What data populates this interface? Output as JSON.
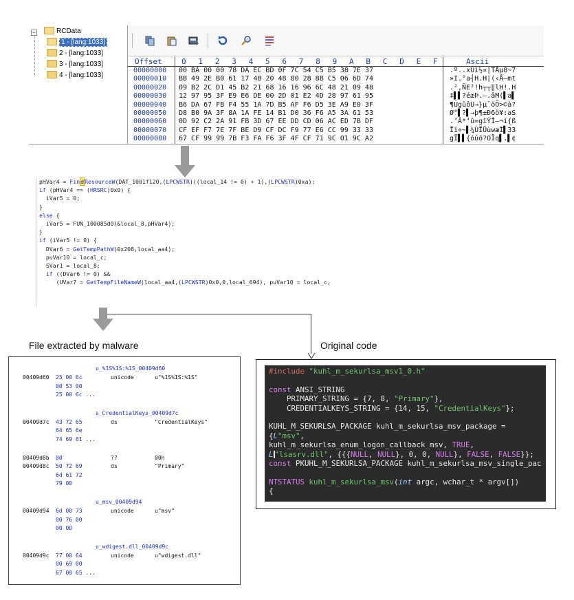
{
  "tree": {
    "root": "RCData",
    "items": [
      "1 - [lang:1033]",
      "2 - [lang:1033]",
      "3 - [lang:1033]",
      "4 - [lang:1033]"
    ]
  },
  "hex": {
    "header": {
      "offset": "Offset",
      "cols": [
        "0",
        "1",
        "2",
        "3",
        "4",
        "5",
        "6",
        "7",
        "8",
        "9",
        "A",
        "B",
        "C",
        "D",
        "E",
        "F"
      ],
      "ascii": "Ascii"
    },
    "rows": [
      {
        "offset": "00000000",
        "bytes": "00 BA 00 00 78 DA EC BD 0F 7C 54 C5 B5 38 7E 37",
        "ascii": ".º..xÚì½¤|TÅµ8~7"
      },
      {
        "offset": "00000010",
        "bytes": "BB 49 2E B0 61 17 48 20 48 80 28 8B C5 06 6D 74",
        "ascii": "»I.°a┤H.H|(‹Å–mt"
      },
      {
        "offset": "00000020",
        "bytes": "09 B2 2C D1 45 B2 21 68 16 16 96 6C 48 21 09 48",
        "ascii": ".²,ÑE²!h┬┬‖lH!.H"
      },
      {
        "offset": "00000030",
        "bytes": "12 97 95 3F E9 E6 DE 00 2D 01 E2 4D 28 97 61 95",
        "ascii": "‡▌▌?éæÞ.–.âM(▌a▌"
      },
      {
        "offset": "00000040",
        "bytes": "B6 DA 67 FB F4 55 1A 7D B5 AF F6 D5 3E A9 E0 3F",
        "ascii": "¶ÚgûôU→}µ¯öÕ>©à?"
      },
      {
        "offset": "00000050",
        "bytes": "D8 B0 9A 3F 8A 1A FE 14 B1 D0 36 F6 A5 3A 61 53",
        "ascii": "Ø°▌?▌→þ¶±Ð6ö¥:aS"
      },
      {
        "offset": "00000060",
        "bytes": "0D 92 C2 2A 91 FB 3D 67 EE DD CD 06 AC ED 7B DF",
        "ascii": ".’Â*‘û=gîÝÍ–¬í{ß"
      },
      {
        "offset": "00000070",
        "bytes": "CF EF F7 7E 7F BE D9 CF DC F9 77 E6 CC 99 33 33",
        "ascii": "Ïï÷~▌¾ÙÏÜùwæÌ▌33"
      },
      {
        "offset": "00000080",
        "bytes": "67 CF 99 99 7B F3 FA F6 3F 4F CF 71 9C 01 9C A2",
        "ascii": "gÏ▌▌{óúö?OÏq▌.▌¢"
      }
    ]
  },
  "decompiled": [
    [
      {
        "t": "pHVar4 = "
      },
      {
        "t": "Fin",
        "c": "fn"
      },
      {
        "t": "d",
        "c": "hl"
      },
      {
        "t": "ResourceW",
        "c": "fn"
      },
      {
        "t": "(DAT_1001f120,("
      },
      {
        "t": "LPCWSTR",
        "c": "kw"
      },
      {
        "t": ")((local_14 != 0) + 1),("
      },
      {
        "t": "LPCWSTR",
        "c": "kw"
      },
      {
        "t": ")0xa);"
      }
    ],
    [
      {
        "t": "if",
        "c": "kw"
      },
      {
        "t": " (pHVar4 == ("
      },
      {
        "t": "HRSRC",
        "c": "kw"
      },
      {
        "t": ")0x0) {"
      }
    ],
    [
      {
        "t": "  iVar5 = 0;"
      }
    ],
    [
      {
        "t": "}"
      }
    ],
    [
      {
        "t": "else",
        "c": "kw"
      },
      {
        "t": " {"
      }
    ],
    [
      {
        "t": "  iVar5 = FUN_100085d0(&local_8,pHVar4);"
      }
    ],
    [
      {
        "t": "}"
      }
    ],
    [
      {
        "t": "if",
        "c": "kw"
      },
      {
        "t": " (iVar5 != 0) {"
      }
    ],
    [
      {
        "t": "  DVar6 = "
      },
      {
        "t": "GetTempPathW",
        "c": "fn"
      },
      {
        "t": "(0x208,local_aa4);"
      }
    ],
    [
      {
        "t": "  puVar10 = local_c;"
      }
    ],
    [
      {
        "t": "  SVar1 = local_8;"
      }
    ],
    [
      {
        "t": "  "
      },
      {
        "t": "if",
        "c": "kw"
      },
      {
        "t": " ((DVar6 != 0) &&"
      }
    ],
    [
      {
        "t": "     (UVar7 = "
      },
      {
        "t": "GetTempFileNameW",
        "c": "fn"
      },
      {
        "t": "(local_aa4,("
      },
      {
        "t": "LPCWSTR",
        "c": "kw"
      },
      {
        "t": ")0x0,0,local_694), puVar10 = local_c,"
      }
    ]
  ],
  "labels": {
    "extracted": "File extracted by malware",
    "original": "Original code"
  },
  "extracted_file": {
    "blocks": [
      {
        "label": "u_%1S%1S:%1S_00409d60",
        "lines": [
          {
            "addr": "00409d60",
            "bytes": "25 00 6c",
            "mn": "unicode",
            "op": "u\"%1S%1S:%1S\""
          },
          {
            "addr": "",
            "bytes": "00 53 00",
            "mn": "",
            "op": ""
          },
          {
            "addr": "",
            "bytes": "25 00 6c ...",
            "mn": "",
            "op": ""
          }
        ]
      },
      {
        "label": "s_CredentialKeys_00409d7c",
        "lines": [
          {
            "addr": "00409d7c",
            "bytes": "43 72 65",
            "mn": "ds",
            "op": "\"CredentialKeys\""
          },
          {
            "addr": "",
            "bytes": "64 65 6e",
            "mn": "",
            "op": ""
          },
          {
            "addr": "",
            "bytes": "74 69 61 ...",
            "mn": "",
            "op": ""
          }
        ]
      },
      {
        "label": "",
        "lines": [
          {
            "addr": "00409d8b",
            "bytes": "00",
            "mn": "??",
            "op": "00h"
          },
          {
            "addr": "00409d8c",
            "bytes": "50 72 69",
            "mn": "ds",
            "op": "\"Primary\""
          },
          {
            "addr": "",
            "bytes": "6d 61 72",
            "mn": "",
            "op": ""
          },
          {
            "addr": "",
            "bytes": "79 00",
            "mn": "",
            "op": ""
          }
        ]
      },
      {
        "label": "u_msv_00409d94",
        "lines": [
          {
            "addr": "00409d94",
            "bytes": "6d 00 73",
            "mn": "unicode",
            "op": "u\"msv\""
          },
          {
            "addr": "",
            "bytes": "00 76 00",
            "mn": "",
            "op": ""
          },
          {
            "addr": "",
            "bytes": "00 00",
            "mn": "",
            "op": ""
          }
        ]
      },
      {
        "label": "u_wdigest.dll_00409d9c",
        "lines": [
          {
            "addr": "00409d9c",
            "bytes": "77 00 64",
            "mn": "unicode",
            "op": "u\"wdigest.dll\""
          },
          {
            "addr": "",
            "bytes": "00 69 00",
            "mn": "",
            "op": ""
          },
          {
            "addr": "",
            "bytes": "67 00 65 ...",
            "mn": "",
            "op": ""
          }
        ]
      }
    ]
  },
  "original_code": [
    [
      {
        "t": "#include ",
        "c": "dpp"
      },
      {
        "t": "\"kuhl_m_sekurlsa_msv1_0.h\"",
        "c": "dstr"
      }
    ],
    [
      {
        "t": ""
      }
    ],
    [
      {
        "t": "const ",
        "c": "dkw"
      },
      {
        "t": "ANSI_STRING"
      }
    ],
    [
      {
        "t": "    PRIMARY_STRING = {7, 8, "
      },
      {
        "t": "\"Primary\"",
        "c": "dstr"
      },
      {
        "t": "},"
      }
    ],
    [
      {
        "t": "    CREDENTIALKEYS_STRING = {14, 15, "
      },
      {
        "t": "\"CredentialKeys\"",
        "c": "dstr"
      },
      {
        "t": "};"
      }
    ],
    [
      {
        "t": ""
      }
    ],
    [
      {
        "t": "KUHL_M_SEKURLSA_PACKAGE kuhl_m_sekurlsa_msv_package ="
      }
    ],
    [
      {
        "t": "{"
      },
      {
        "t": "L",
        "c": "dty"
      },
      {
        "t": "\"msv\"",
        "c": "dstr"
      },
      {
        "t": ","
      }
    ],
    [
      {
        "t": "kuhl_m_sekurlsa_enum_logon_callback_msv, "
      },
      {
        "t": "TRUE",
        "c": "dkw"
      },
      {
        "t": ","
      }
    ],
    [
      {
        "t": "L",
        "c": "dty"
      },
      {
        "t": "|",
        "c": "caret"
      },
      {
        "t": "\"lsasrv.dll\"",
        "c": "dstr"
      },
      {
        "t": ", {{{"
      },
      {
        "t": "NULL",
        "c": "dkw"
      },
      {
        "t": ", "
      },
      {
        "t": "NULL",
        "c": "dkw"
      },
      {
        "t": "}, 0, 0, "
      },
      {
        "t": "NULL",
        "c": "dkw"
      },
      {
        "t": "}, "
      },
      {
        "t": "FALSE",
        "c": "dkw"
      },
      {
        "t": ", "
      },
      {
        "t": "FALSE",
        "c": "dkw"
      },
      {
        "t": "}};"
      }
    ],
    [
      {
        "t": "const ",
        "c": "dkw"
      },
      {
        "t": "PKUHL_M_SEKURLSA_PACKAGE kuhl_m_sekurlsa_msv_single_pac"
      }
    ],
    [
      {
        "t": ""
      }
    ],
    [
      {
        "t": "NTSTATUS ",
        "c": "dkw"
      },
      {
        "t": "kuhl_m_sekurlsa_msv",
        "c": "dstr"
      },
      {
        "t": "("
      },
      {
        "t": "int ",
        "c": "dty"
      },
      {
        "t": "argc, wchar_t * argv[])"
      }
    ],
    [
      {
        "t": "{"
      }
    ]
  ]
}
